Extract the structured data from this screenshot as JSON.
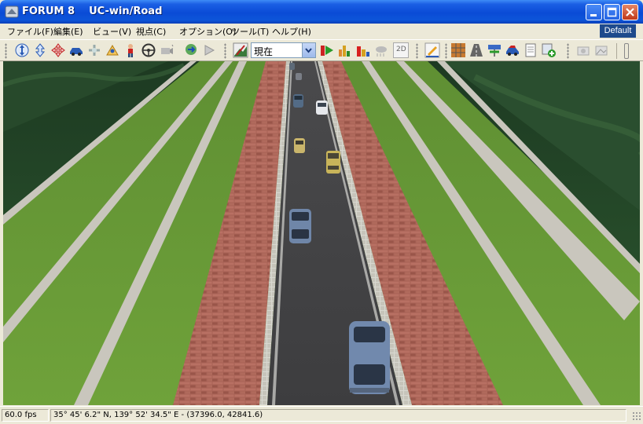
{
  "window": {
    "title": "FORUM 8    UC-win/Road",
    "minimize_icon": "minimize-icon",
    "maximize_icon": "maximize-icon",
    "close_icon": "close-icon"
  },
  "menu": {
    "items": [
      {
        "label": "ファイル(F)"
      },
      {
        "label": "編集(E)"
      },
      {
        "label": "ビュー(V)"
      },
      {
        "label": "視点(C)"
      },
      {
        "label": "オプション(O)"
      },
      {
        "label": "ツール(T)"
      },
      {
        "label": "ヘルプ(H)"
      }
    ],
    "profile_badge": "Default"
  },
  "toolbar": {
    "view_select_value": "現在",
    "tool_icons": [
      "move-icon",
      "up-down-icon",
      "rotate-icon",
      "drive-car-icon",
      "fly-icon",
      "walk-icon",
      "person-icon",
      "steering-wheel-icon",
      "camera-icon",
      "route-icon",
      "play-icon",
      "terrain-view-icon",
      "record-start-icon",
      "bar-chart-icon",
      "bar-chart-red-icon",
      "weather-icon",
      "view-2d-icon",
      "edit-icon",
      "grid-icon",
      "road-icon",
      "signal-icon",
      "vehicle-icon",
      "document-icon",
      "add-icon",
      "screenshot-icon",
      "gallery-icon"
    ],
    "view_2d_label": "2D"
  },
  "status": {
    "fps": "60.0 fps",
    "coordinates": "35°  45' 6.2\" N, 139°  52' 34.5\" E  -  (37396.0, 42841.6)"
  }
}
